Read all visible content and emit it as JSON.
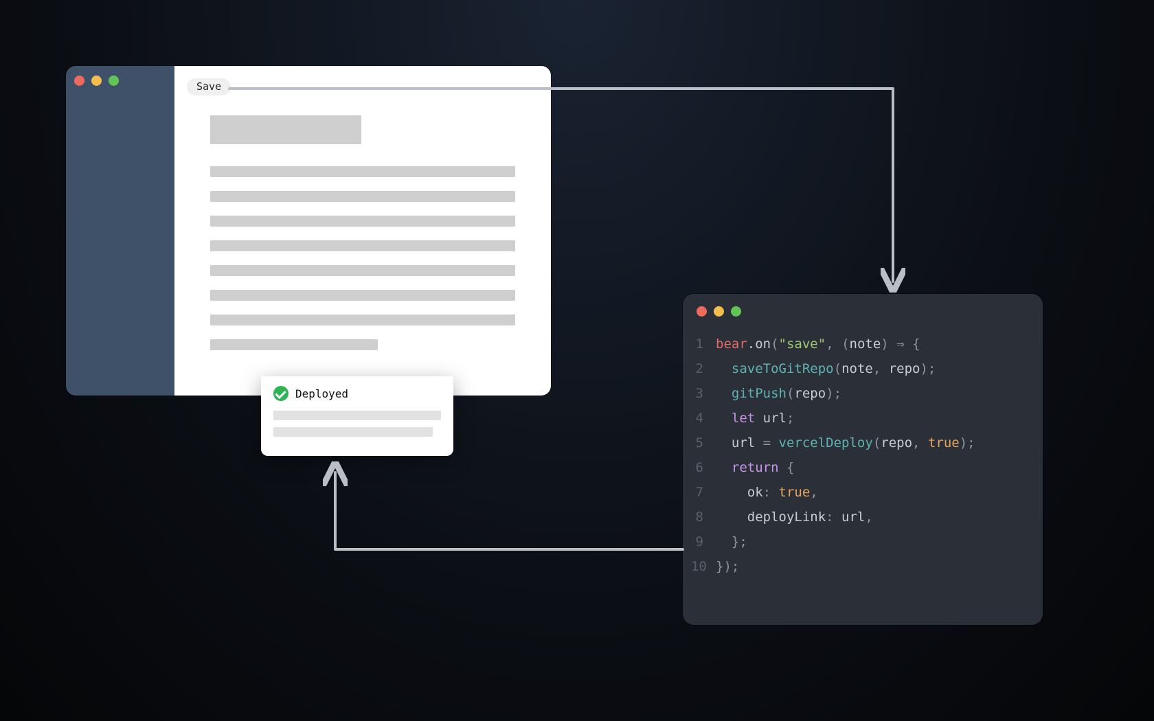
{
  "notes_app": {
    "save_chip": "Save",
    "deployed_label": "Deployed"
  },
  "code_editor": {
    "lines": [
      {
        "n": 1,
        "tokens": [
          [
            "id",
            "bear"
          ],
          [
            "prop",
            ".on"
          ],
          [
            "punc",
            "("
          ],
          [
            "str",
            "\"save\""
          ],
          [
            "punc",
            ", ("
          ],
          [
            "var",
            "note"
          ],
          [
            "punc",
            ") "
          ],
          [
            "punc",
            "⇒"
          ],
          [
            "punc",
            " {"
          ]
        ]
      },
      {
        "n": 2,
        "indent": 1,
        "tokens": [
          [
            "fn",
            "saveToGitRepo"
          ],
          [
            "punc",
            "("
          ],
          [
            "var",
            "note"
          ],
          [
            "punc",
            ", "
          ],
          [
            "var",
            "repo"
          ],
          [
            "punc",
            ");"
          ]
        ]
      },
      {
        "n": 3,
        "indent": 1,
        "tokens": [
          [
            "fn",
            "gitPush"
          ],
          [
            "punc",
            "("
          ],
          [
            "var",
            "repo"
          ],
          [
            "punc",
            ");"
          ]
        ]
      },
      {
        "n": 4,
        "indent": 1,
        "tokens": [
          [
            "kw",
            "let"
          ],
          [
            "punc",
            " "
          ],
          [
            "var",
            "url"
          ],
          [
            "punc",
            ";"
          ]
        ]
      },
      {
        "n": 5,
        "indent": 1,
        "tokens": [
          [
            "var",
            "url"
          ],
          [
            "punc",
            " = "
          ],
          [
            "fn",
            "vercelDeploy"
          ],
          [
            "punc",
            "("
          ],
          [
            "var",
            "repo"
          ],
          [
            "punc",
            ", "
          ],
          [
            "num",
            "true"
          ],
          [
            "punc",
            ");"
          ]
        ]
      },
      {
        "n": 6,
        "indent": 1,
        "tokens": [
          [
            "kw",
            "return"
          ],
          [
            "punc",
            " {"
          ]
        ]
      },
      {
        "n": 7,
        "indent": 2,
        "tokens": [
          [
            "var",
            "ok"
          ],
          [
            "punc",
            ": "
          ],
          [
            "num",
            "true"
          ],
          [
            "punc",
            ","
          ]
        ]
      },
      {
        "n": 8,
        "indent": 2,
        "tokens": [
          [
            "var",
            "deployLink"
          ],
          [
            "punc",
            ": "
          ],
          [
            "var",
            "url"
          ],
          [
            "punc",
            ","
          ]
        ]
      },
      {
        "n": 9,
        "indent": 1,
        "tokens": [
          [
            "punc",
            "};"
          ]
        ]
      },
      {
        "n": 10,
        "tokens": [
          [
            "punc",
            "});"
          ]
        ]
      }
    ]
  },
  "connectors": {
    "stroke": "#b9bec7",
    "stroke_width": 4
  }
}
